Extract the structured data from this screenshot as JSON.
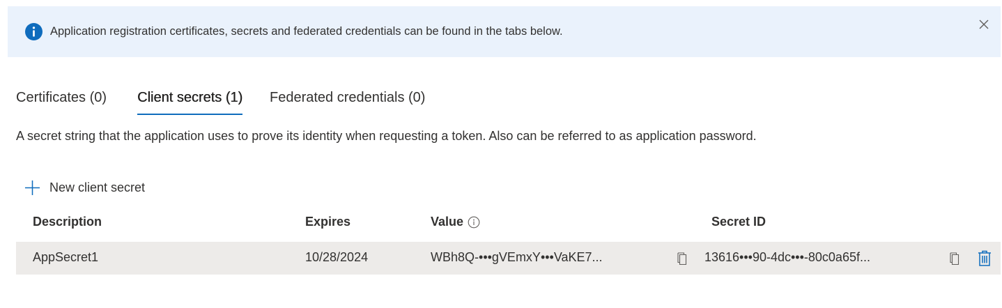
{
  "banner": {
    "message": "Application registration certificates, secrets and federated credentials can be found in the tabs below.",
    "icon": "info-icon",
    "close_icon": "close-icon",
    "accent_color": "#0f6cbd",
    "background_color": "#eaf2fc"
  },
  "tabs": [
    {
      "label": "Certificates (0)",
      "active": false
    },
    {
      "label": "Client secrets (1)",
      "active": true
    },
    {
      "label": "Federated credentials (0)",
      "active": false
    }
  ],
  "description": "A secret string that the application uses to prove its identity when requesting a token. Also can be referred to as application password.",
  "toolbar": {
    "new_secret_label": "New client secret",
    "new_secret_icon": "plus-icon"
  },
  "table": {
    "columns": [
      "Description",
      "Expires",
      "Value",
      "Secret ID"
    ],
    "rows": [
      {
        "description": "AppSecret1",
        "expires": "10/28/2024",
        "value": "WBh8Q-•••gVEmxY•••VaKE7...",
        "secret_id": "13616•••90-4dc•••-80c0a65f..."
      }
    ]
  }
}
